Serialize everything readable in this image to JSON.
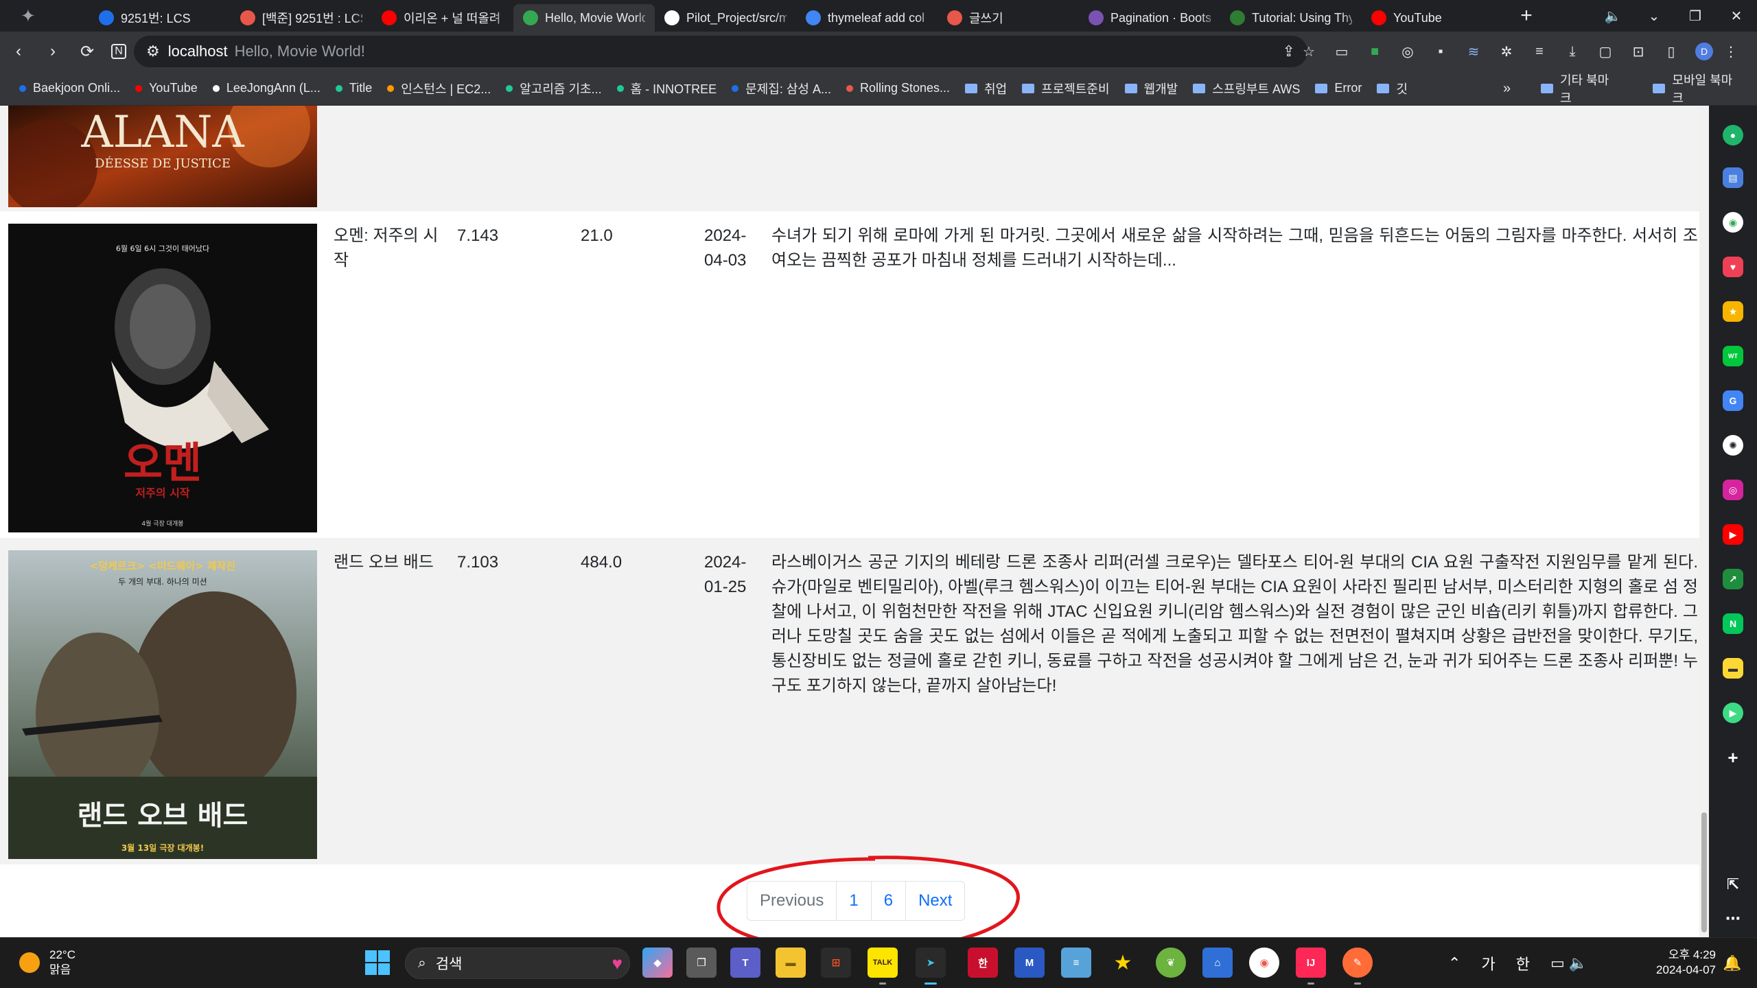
{
  "browser": {
    "tabs": [
      {
        "title": "9251번: LCS",
        "favicon": "code-icon",
        "color": "#1f6feb"
      },
      {
        "title": "[백준] 9251번 : LCS",
        "favicon": "tistory-icon",
        "color": "#e8584a"
      },
      {
        "title": "이리온 + 널 떠올려",
        "favicon": "youtube-icon",
        "color": "#ff0000"
      },
      {
        "title": "Hello, Movie World!",
        "favicon": "globe-icon",
        "color": "#34a853"
      },
      {
        "title": "Pilot_Project/src/main",
        "favicon": "github-icon",
        "color": "#ffffff"
      },
      {
        "title": "thymeleaf add col",
        "favicon": "google-icon",
        "color": "#4285f4"
      },
      {
        "title": "글쓰기",
        "favicon": "tistory-icon",
        "color": "#e8584a"
      },
      {
        "title": "Pagination · Bootstrap",
        "favicon": "bootstrap-icon",
        "color": "#7952b3"
      },
      {
        "title": "Tutorial: Using Thymeleaf",
        "favicon": "check-icon",
        "color": "#2e7d32"
      },
      {
        "title": "YouTube",
        "favicon": "youtube-icon",
        "color": "#ff0000"
      }
    ],
    "active_tab_index": 3,
    "address": {
      "host": "localhost",
      "title": "Hello, Movie World!"
    },
    "bookmarks": [
      {
        "label": "Baekjoon Onli...",
        "type": "dot",
        "color": "#1f6feb"
      },
      {
        "label": "YouTube",
        "type": "dot",
        "color": "#ff0000"
      },
      {
        "label": "LeeJongAnn (L...",
        "type": "dot",
        "color": "#ffffff"
      },
      {
        "label": "Title",
        "type": "dot",
        "color": "#20c997"
      },
      {
        "label": "인스턴스 | EC2...",
        "type": "dot",
        "color": "#ff9900"
      },
      {
        "label": "알고리즘 기초...",
        "type": "dot",
        "color": "#20c997"
      },
      {
        "label": "홈 - INNOTREE",
        "type": "dot",
        "color": "#20c997"
      },
      {
        "label": "문제집: 삼성 A...",
        "type": "dot",
        "color": "#1f6feb"
      },
      {
        "label": "Rolling Stones...",
        "type": "dot",
        "color": "#e8584a"
      },
      {
        "label": "취업",
        "type": "folder"
      },
      {
        "label": "프로젝트준비",
        "type": "folder"
      },
      {
        "label": "웹개발",
        "type": "folder"
      },
      {
        "label": "스프링부트 AWS",
        "type": "folder"
      },
      {
        "label": "Error",
        "type": "folder"
      },
      {
        "label": "깃",
        "type": "folder"
      }
    ],
    "bookmarks_more": "»",
    "bookmarks_right": [
      {
        "label": "기타 북마크"
      },
      {
        "label": "모바일 북마크"
      }
    ],
    "profile_initial": "D"
  },
  "page": {
    "movies": [
      {
        "poster_title": "ALANA",
        "poster_subtitle": "DÉESSE DE JUSTICE"
      },
      {
        "title": "오멘: 저주의 시작",
        "rating": "7.143",
        "vote_count": "21.0",
        "release_date": "2024-04-03",
        "overview": "수녀가 되기 위해 로마에 가게 된 마거릿. 그곳에서 새로운 삶을 시작하려는 그때, 믿음을 뒤흔드는 어둠의 그림자를 마주한다. 서서히 조여오는 끔찍한 공포가 마침내 정체를 드러내기 시작하는데...",
        "poster_tagline": "6월 6일 6시 그것이 태어났다",
        "poster_title": "오멘",
        "poster_subtitle": "저주의 시작",
        "poster_release": "4월 극장 대개봉"
      },
      {
        "title": "랜드 오브 배드",
        "rating": "7.103",
        "vote_count": "484.0",
        "release_date": "2024-01-25",
        "overview": "라스베이거스 공군 기지의 베테랑 드론 조종사 리퍼(러셀 크로우)는 델타포스 티어-원 부대의 CIA 요원 구출작전 지원임무를 맡게 된다. 슈가(마일로 벤티밀리아), 아벨(루크 헴스워스)이 이끄는 티어-원 부대는 CIA 요원이 사라진 필리핀 남서부, 미스터리한 지형의 홀로 섬 정찰에 나서고, 이 위험천만한 작전을 위해 JTAC 신입요원 키니(리암 헴스워스)와 실전 경험이 많은 군인 비숍(리키 휘틀)까지 합류한다. 그러나 도망칠 곳도 숨을 곳도 없는 섬에서 이들은 곧 적에게 노출되고 피할 수 없는 전면전이 펼쳐지며 상황은 급반전을 맞이한다. 무기도, 통신장비도 없는 정글에 홀로 갇힌 키니, 동료를 구하고 작전을 성공시켜야 할 그에게 남은 건, 눈과 귀가 되어주는 드론 조종사 리퍼뿐! 누구도 포기하지 않는다, 끝까지 살아남는다!",
        "poster_tagline": "<덩케르크> <미드웨이> 제작진",
        "poster_tagline2": "두 개의 부대. 하나의 미션",
        "poster_title": "랜드 오브 배드",
        "poster_release": "3월 13일 극장 대개봉!"
      }
    ],
    "pagination": {
      "previous": "Previous",
      "pages": [
        "1",
        "6"
      ],
      "next": "Next"
    }
  },
  "taskbar": {
    "weather_temp": "22°C",
    "weather_desc": "맑음",
    "search_placeholder": "검색",
    "ime_mode": "가",
    "ime_lang": "한",
    "clock_time": "오후 4:29",
    "clock_date": "2024-04-07"
  }
}
